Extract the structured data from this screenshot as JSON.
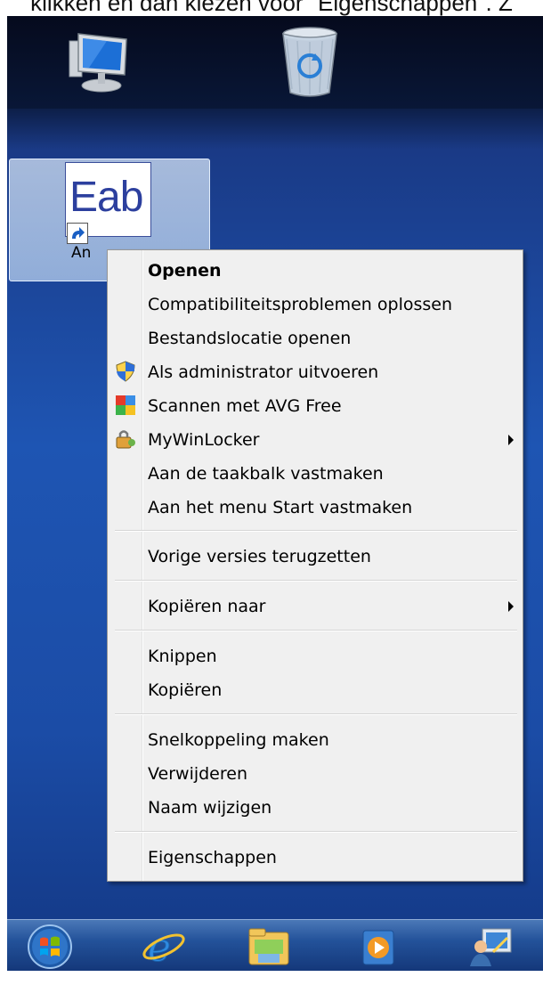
{
  "caption": "klikken en dan kiezen voor \"Eigenschappen\". Z",
  "desktop": {
    "top_icons": [
      "computer-icon",
      "recycle-bin-icon"
    ],
    "selected_icon": {
      "image_text": "Eab",
      "label": "An"
    }
  },
  "context_menu": {
    "items": [
      {
        "label": "Openen",
        "bold": true
      },
      {
        "label": "Compatibiliteitsproblemen oplossen"
      },
      {
        "label": "Bestandslocatie openen"
      },
      {
        "label": "Als administrator uitvoeren",
        "icon": "uac-shield-icon"
      },
      {
        "label": "Scannen met AVG Free",
        "icon": "avg-icon"
      },
      {
        "label": "MyWinLocker",
        "icon": "mywinlocker-icon",
        "submenu": true
      },
      {
        "label": "Aan de taakbalk vastmaken"
      },
      {
        "label": "Aan het menu Start vastmaken"
      },
      {
        "label": "Vorige versies terugzetten"
      },
      {
        "label": "Kopiëren naar",
        "submenu": true
      },
      {
        "label": "Knippen"
      },
      {
        "label": "Kopiëren"
      },
      {
        "label": "Snelkoppeling maken"
      },
      {
        "label": "Verwijderen"
      },
      {
        "label": "Naam wijzigen"
      },
      {
        "label": "Eigenschappen"
      }
    ]
  },
  "taskbar": {
    "icons": [
      "start-orb-icon",
      "internet-explorer-icon",
      "file-explorer-icon",
      "media-player-icon",
      "network-user-icon"
    ]
  }
}
